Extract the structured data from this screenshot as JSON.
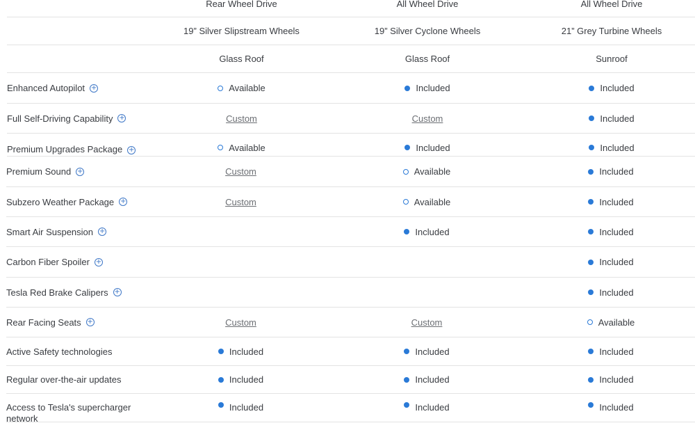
{
  "header": {
    "drive": [
      "Rear Wheel Drive",
      "All Wheel Drive",
      "All Wheel Drive"
    ],
    "wheels": [
      "19” Silver Slipstream Wheels",
      "19” Silver Cyclone Wheels",
      "21” Grey Turbine Wheels"
    ],
    "roof": [
      "Glass Roof",
      "Glass Roof",
      "Sunroof"
    ]
  },
  "rows": [
    {
      "label": "Enhanced Autopilot",
      "c": [
        "Available",
        "Included",
        "Included"
      ]
    },
    {
      "label": "Full Self-Driving Capability",
      "c": [
        "Custom",
        "Custom",
        "Included"
      ]
    },
    {
      "label": "Premium Upgrades Package",
      "c": [
        "Available",
        "Included",
        "Included"
      ]
    },
    {
      "label": "Premium Sound",
      "c": [
        "Custom",
        "Available",
        "Included"
      ]
    },
    {
      "label": "Subzero Weather Package",
      "c": [
        "Custom",
        "Available",
        "Included"
      ]
    },
    {
      "label": "Smart Air Suspension",
      "c": [
        "",
        "Included",
        "Included"
      ]
    },
    {
      "label": "Carbon Fiber Spoiler",
      "c": [
        "",
        "",
        "Included"
      ]
    },
    {
      "label": "Tesla Red Brake Calipers",
      "c": [
        "",
        "",
        "Included"
      ]
    },
    {
      "label": "Rear Facing Seats",
      "c": [
        "Custom",
        "Custom",
        "Available"
      ]
    },
    {
      "label": "Active Safety technologies",
      "c": [
        "Included",
        "Included",
        "Included"
      ]
    },
    {
      "label": "Regular over-the-air updates",
      "c": [
        "Included",
        "Included",
        "Included"
      ]
    },
    {
      "label": "Access to Tesla's supercharger network",
      "c": [
        "Included",
        "Included",
        "Included"
      ]
    }
  ],
  "status_colors": {
    "accent": "#2a7ad7",
    "custom": "#6b6e73"
  },
  "icons": {
    "included": "filled-dot-icon",
    "available": "ring-icon",
    "info": "plus-circle-icon"
  }
}
